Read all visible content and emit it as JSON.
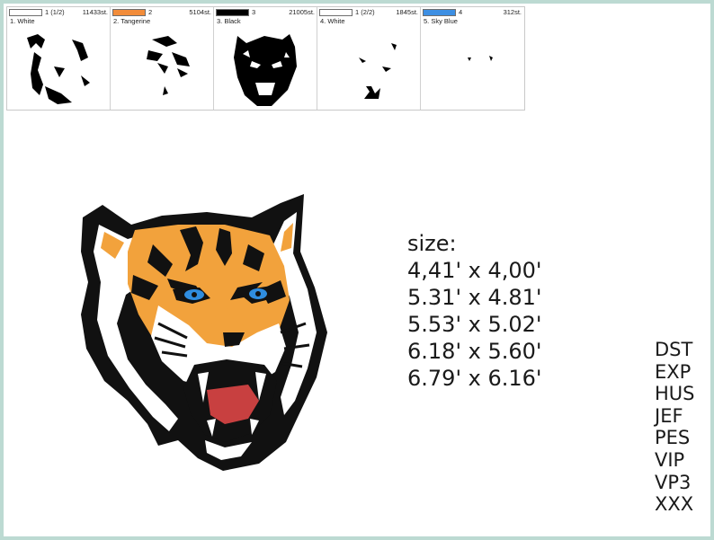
{
  "color_stops": [
    {
      "index": "1 (1/2)",
      "stitches": "11433st.",
      "name": "1. White",
      "color": "#ffffff"
    },
    {
      "index": "2",
      "stitches": "5104st.",
      "name": "2. Tangerine",
      "color": "#f28c3a"
    },
    {
      "index": "3",
      "stitches": "21005st.",
      "name": "3. Black",
      "color": "#000000"
    },
    {
      "index": "1 (2/2)",
      "stitches": "1845st.",
      "name": "4. White",
      "color": "#ffffff"
    },
    {
      "index": "4",
      "stitches": "312st.",
      "name": "5. Sky Blue",
      "color": "#3d8fe3"
    }
  ],
  "size_heading": "size:",
  "sizes": [
    "4,41' x 4,00'",
    "5.31' x 4.81'",
    "5.53' x 5.02'",
    "6.18' x 5.60'",
    "6.79' x 6.16'"
  ],
  "formats": [
    "DST",
    "EXP",
    "HUS",
    "JEF",
    "PES",
    "VIP",
    "VP3",
    "XXX"
  ],
  "colors": {
    "frame": "#bcdad2",
    "orange": "#f2a23c",
    "eye": "#2f8de0"
  }
}
